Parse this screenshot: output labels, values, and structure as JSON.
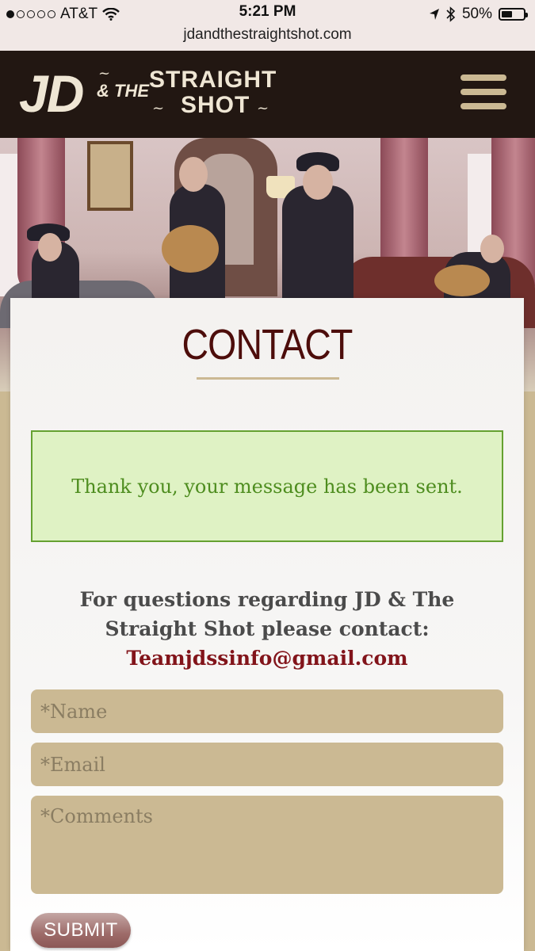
{
  "status_bar": {
    "carrier": "AT&T",
    "signal_bars_filled": 1,
    "signal_bars_total": 5,
    "time": "5:21 PM",
    "battery_percent": "50%",
    "battery_level": 0.5,
    "icons": [
      "wifi-icon",
      "location-arrow-icon",
      "bluetooth-icon",
      "battery-icon"
    ]
  },
  "browser": {
    "url": "jdandthestraightshot.com"
  },
  "header": {
    "logo": {
      "part1": "JD",
      "part2": "& THE",
      "part3": "STRAIGHT",
      "part4": "SHOT"
    },
    "menu_icon": "hamburger-menu-icon"
  },
  "page": {
    "title": "CONTACT",
    "success_message": "Thank you, your message has been sent.",
    "info_text": "For questions regarding JD & The Straight Shot please contact:",
    "contact_email": "Teamjdssinfo@gmail.com"
  },
  "form": {
    "name_placeholder": "*Name",
    "email_placeholder": "*Email",
    "comments_placeholder": "*Comments",
    "submit_label": "SUBMIT"
  },
  "colors": {
    "header_bg": "#221712",
    "accent_tan": "#cbb993",
    "title_maroon": "#4d0d0b",
    "success_green": "#4e8d1f",
    "success_bg": "#dff2c4",
    "email_red": "#82141a"
  }
}
